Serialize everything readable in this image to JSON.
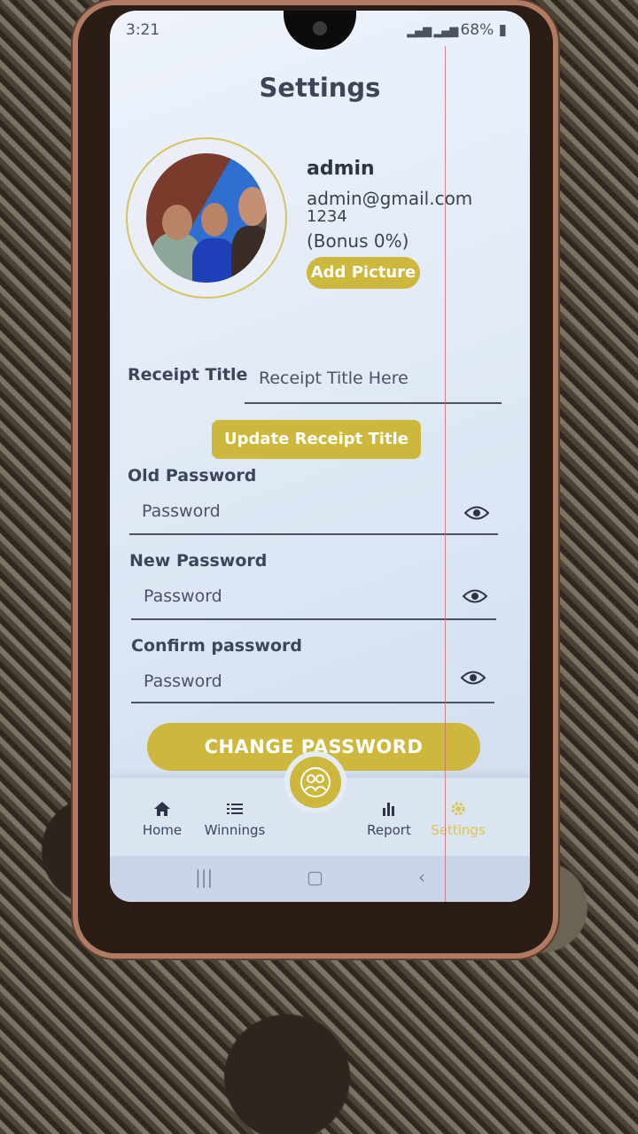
{
  "status_bar": {
    "time": "3:21",
    "battery": "68%"
  },
  "header": {
    "title": "Settings"
  },
  "profile": {
    "name": "admin",
    "email": "admin@gmail.com",
    "code": "1234",
    "bonus": "(Bonus 0%)",
    "add_picture_label": "Add Picture"
  },
  "receipt": {
    "label": "Receipt Title",
    "value": "Receipt Title Here",
    "update_label": "Update Receipt Title"
  },
  "password": {
    "old_label": "Old Password",
    "old_placeholder": "Password",
    "new_label": "New Password",
    "new_placeholder": "Password",
    "confirm_label": "Confirm password",
    "confirm_placeholder": "Password",
    "change_label": "CHANGE PASSWORD"
  },
  "nav": {
    "items": [
      {
        "label": "Home",
        "icon": "home-icon"
      },
      {
        "label": "Winnings",
        "icon": "list-icon"
      },
      {
        "label": "Report",
        "icon": "bar-chart-icon"
      },
      {
        "label": "Settings",
        "icon": "gear-icon"
      }
    ],
    "fab_icon": "people-icon"
  },
  "colors": {
    "accent": "#cdb73c",
    "text": "#3d4658",
    "active_nav": "#d9c650"
  }
}
